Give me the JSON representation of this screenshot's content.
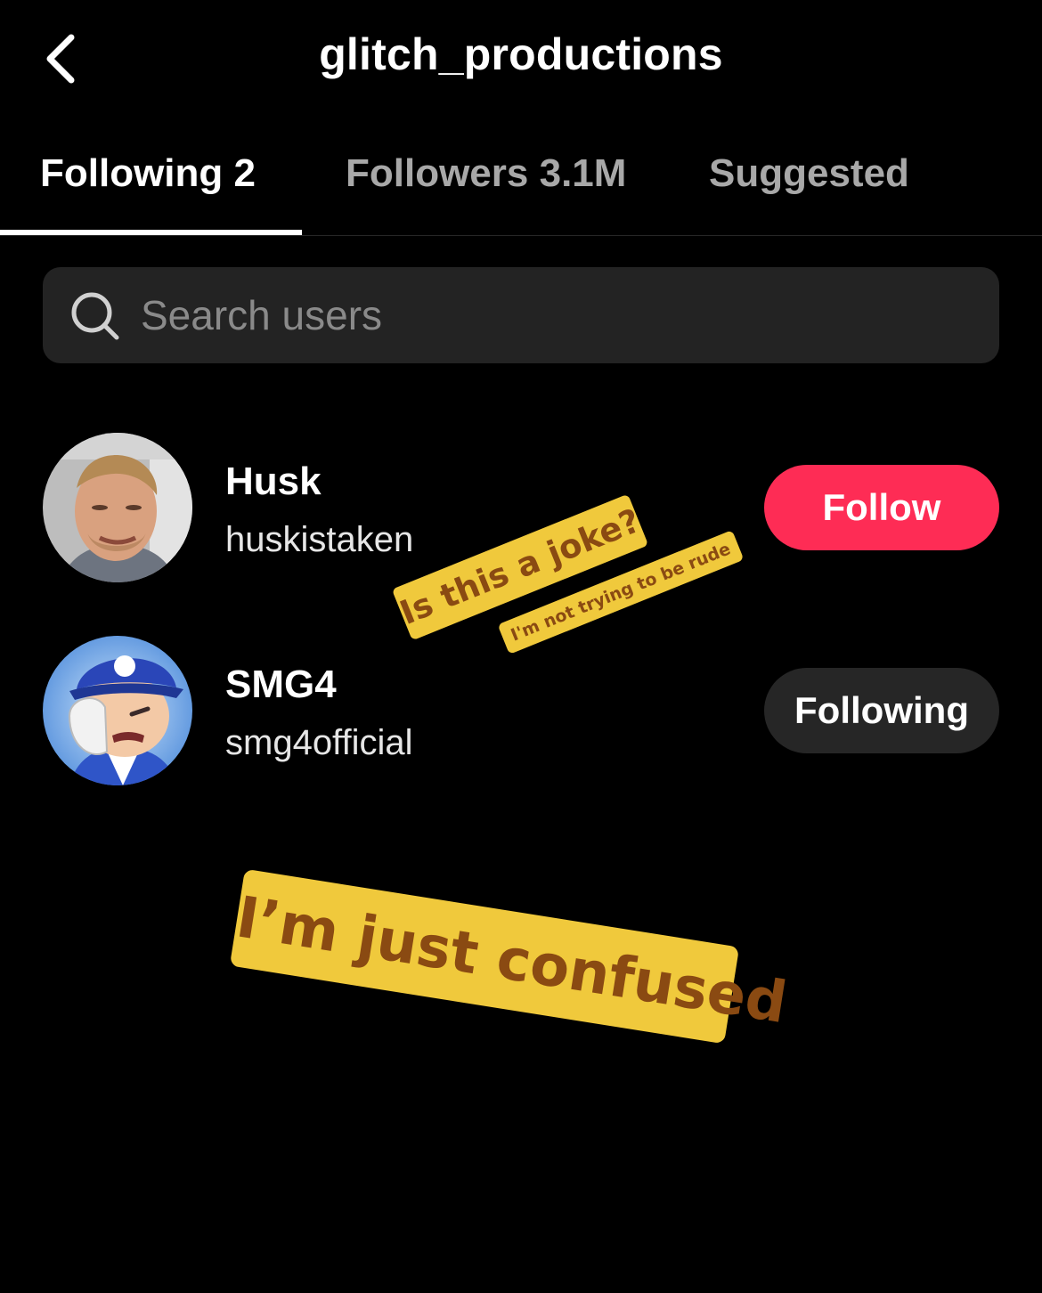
{
  "header": {
    "title": "glitch_productions",
    "back_icon": "chevron-left-icon"
  },
  "tabs": [
    {
      "label": "Following 2",
      "active": true
    },
    {
      "label": "Followers 3.1M",
      "active": false
    },
    {
      "label": "Suggested",
      "active": false
    }
  ],
  "search": {
    "placeholder": "Search users",
    "value": "",
    "icon": "search-icon"
  },
  "users": [
    {
      "display_name": "Husk",
      "handle": "huskistaken",
      "button_label": "Follow",
      "button_state": "follow"
    },
    {
      "display_name": "SMG4",
      "handle": "smg4official",
      "button_label": "Following",
      "button_state": "following"
    }
  ],
  "stickers": [
    {
      "text": "Is this a joke?"
    },
    {
      "text": "I'm not trying to be rude"
    },
    {
      "text": "I’m just confused"
    }
  ],
  "colors": {
    "background": "#000000",
    "follow_button": "#fe2c55",
    "following_button": "#262626",
    "search_bg": "#232323",
    "sticker_bg": "#f0c93c",
    "sticker_text": "#8a4a12"
  }
}
